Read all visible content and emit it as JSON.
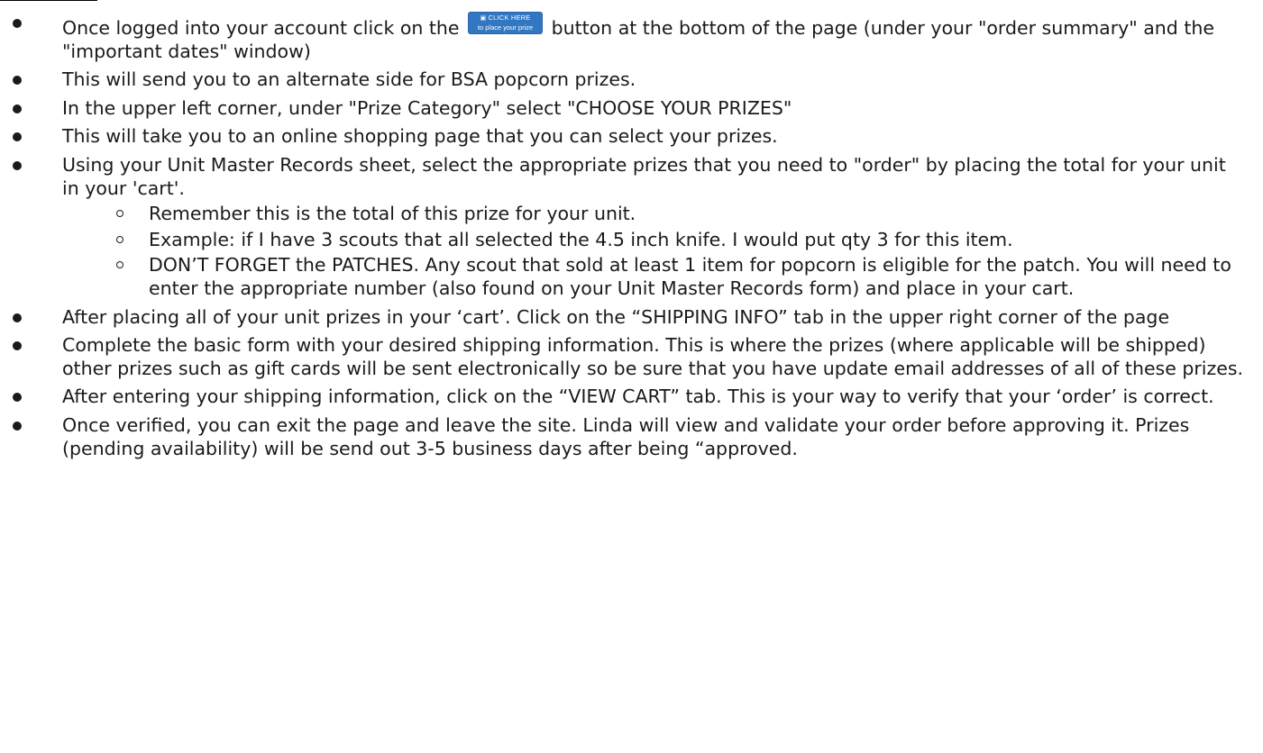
{
  "button": {
    "icon": "gift-icon",
    "line1": "CLICK HERE",
    "line2": "to place your prize order!"
  },
  "steps": [
    {
      "pre": "Once logged into your account click on the ",
      "post": " button at the bottom of the page (under your \"order summary\" and the \"important dates\" window)"
    },
    {
      "text": "This will send you to an alternate side for BSA popcorn prizes."
    },
    {
      "text": "In the upper left corner, under \"Prize Category\" select \"CHOOSE YOUR PRIZES\""
    },
    {
      "text": "This will take you to an online shopping page that you can select your prizes."
    },
    {
      "text": "Using your Unit Master Records sheet, select the appropriate prizes that you need to \"order\" by placing the total for your unit in your 'cart'.",
      "subitems": [
        "Remember this is the total of this prize for your unit.",
        "Example: if I have 3 scouts that all selected the 4.5 inch knife. I would put qty 3 for this item.",
        "DON’T FORGET the PATCHES. Any scout that sold at least 1 item for popcorn is eligible for the patch. You will need to enter the appropriate number (also found on your Unit Master Records form) and place in your cart."
      ]
    },
    {
      "text": "After placing all of your unit prizes in your ‘cart’. Click on the “SHIPPING INFO” tab in the upper right corner of the page"
    },
    {
      "text": "Complete the basic form with your desired shipping information. This is where the prizes (where applicable will be shipped) other prizes such as gift cards will be sent electronically so be sure that you have update email addresses of all of these prizes."
    },
    {
      "text": "After entering your shipping information, click on the “VIEW CART” tab. This is your way to verify that your ‘order’ is correct."
    },
    {
      "text": "Once verified, you can exit the page and leave the site. Linda will view and validate your order before approving it. Prizes (pending availability) will be send out 3-5 business days after being “approved."
    }
  ]
}
